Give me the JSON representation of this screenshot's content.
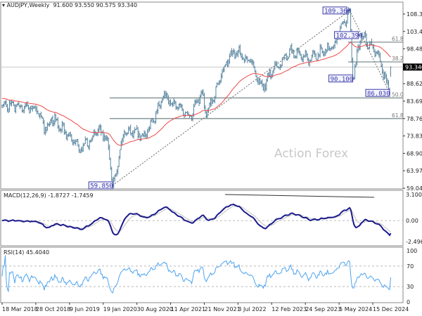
{
  "header": {
    "symbol": "AUDJPY,Weekly",
    "ohlc": "91.600 93.550 90.575 93.340"
  },
  "watermark": "Action Forex",
  "chart_data": [
    {
      "type": "candlestick",
      "title": "AUDJPY,Weekly",
      "last_bar": {
        "open": 91.6,
        "high": 93.55,
        "low": 90.575,
        "close": 93.34
      },
      "current_price": "93.340",
      "price_pivots": [
        [
          "2018-03-18",
          82.5
        ],
        [
          "2018-10-28",
          81.5
        ],
        [
          "2019-01-06",
          75.5
        ],
        [
          "2019-02-10",
          79.0
        ],
        [
          "2019-08-25",
          70.0
        ],
        [
          "2019-12-15",
          75.5
        ],
        [
          "2020-02-16",
          73.0
        ],
        [
          "2020-03-22",
          59.85
        ],
        [
          "2020-06-07",
          75.0
        ],
        [
          "2020-10-25",
          74.0
        ],
        [
          "2021-02-21",
          85.0
        ],
        [
          "2021-08-22",
          79.5
        ],
        [
          "2021-11-07",
          86.2
        ],
        [
          "2021-12-05",
          79.5
        ],
        [
          "2022-04-10",
          94.0
        ],
        [
          "2022-06-05",
          98.0
        ],
        [
          "2022-09-25",
          95.0
        ],
        [
          "2022-12-18",
          87.0
        ],
        [
          "2023-01-22",
          91.0
        ],
        [
          "2023-06-25",
          98.0
        ],
        [
          "2023-10-08",
          95.5
        ],
        [
          "2024-03-24",
          99.0
        ],
        [
          "2024-07-14",
          109.36
        ],
        [
          "2024-08-04",
          90.1
        ],
        [
          "2024-09-29",
          102.39
        ],
        [
          "2024-12-15",
          99.0
        ],
        [
          "2025-02-02",
          95.0
        ],
        [
          "2025-04-06",
          86.03
        ],
        [
          "2025-04-13",
          93.34
        ]
      ],
      "moving_average_color": "#f04848",
      "bar_color": "#5a86a0",
      "y_ticks": [
        "108.345",
        "103.415",
        "98.485",
        "88.625",
        "83.695",
        "78.765",
        "73.835",
        "68.905",
        "63.975",
        "59.045"
      ],
      "ylim": [
        59.045,
        108.345
      ],
      "price_labels": [
        "109.360",
        "102.390",
        "90.100",
        "86.030",
        "59.850"
      ],
      "fib_levels": [
        {
          "label": "61.8",
          "price": 100.4
        },
        {
          "label": "38.2",
          "price": 94.8
        },
        {
          "label": "50.0",
          "price": 84.605
        },
        {
          "label": "61.8",
          "price": 78.765
        }
      ],
      "x_ticks": [
        "18 Mar 2018",
        "28 Oct 2018",
        "9 Jun 2019",
        "19 Jan 2020",
        "30 Aug 2020",
        "11 Apr 2021",
        "21 Nov 2021",
        "3 Jul 2022",
        "12 Feb 2023",
        "24 Sep 2023",
        "5 May 2024",
        "15 Dec 2024"
      ]
    },
    {
      "type": "line",
      "title": "MACD(12,26,9) -1.8727 -1.7459",
      "y_ticks": [
        "3.1006",
        "0.00",
        "-2.4969"
      ],
      "ylim": [
        -2.4969,
        3.1006
      ],
      "macd_color": "#1a1a8c",
      "signal_color": "#c0c0c0"
    },
    {
      "type": "line",
      "title": "RSI(14) 45.4040",
      "y_ticks": [
        "100",
        "70",
        "30",
        "0"
      ],
      "ylim": [
        0,
        100
      ],
      "levels": [
        70,
        30
      ],
      "color": "#4da3f0"
    }
  ]
}
